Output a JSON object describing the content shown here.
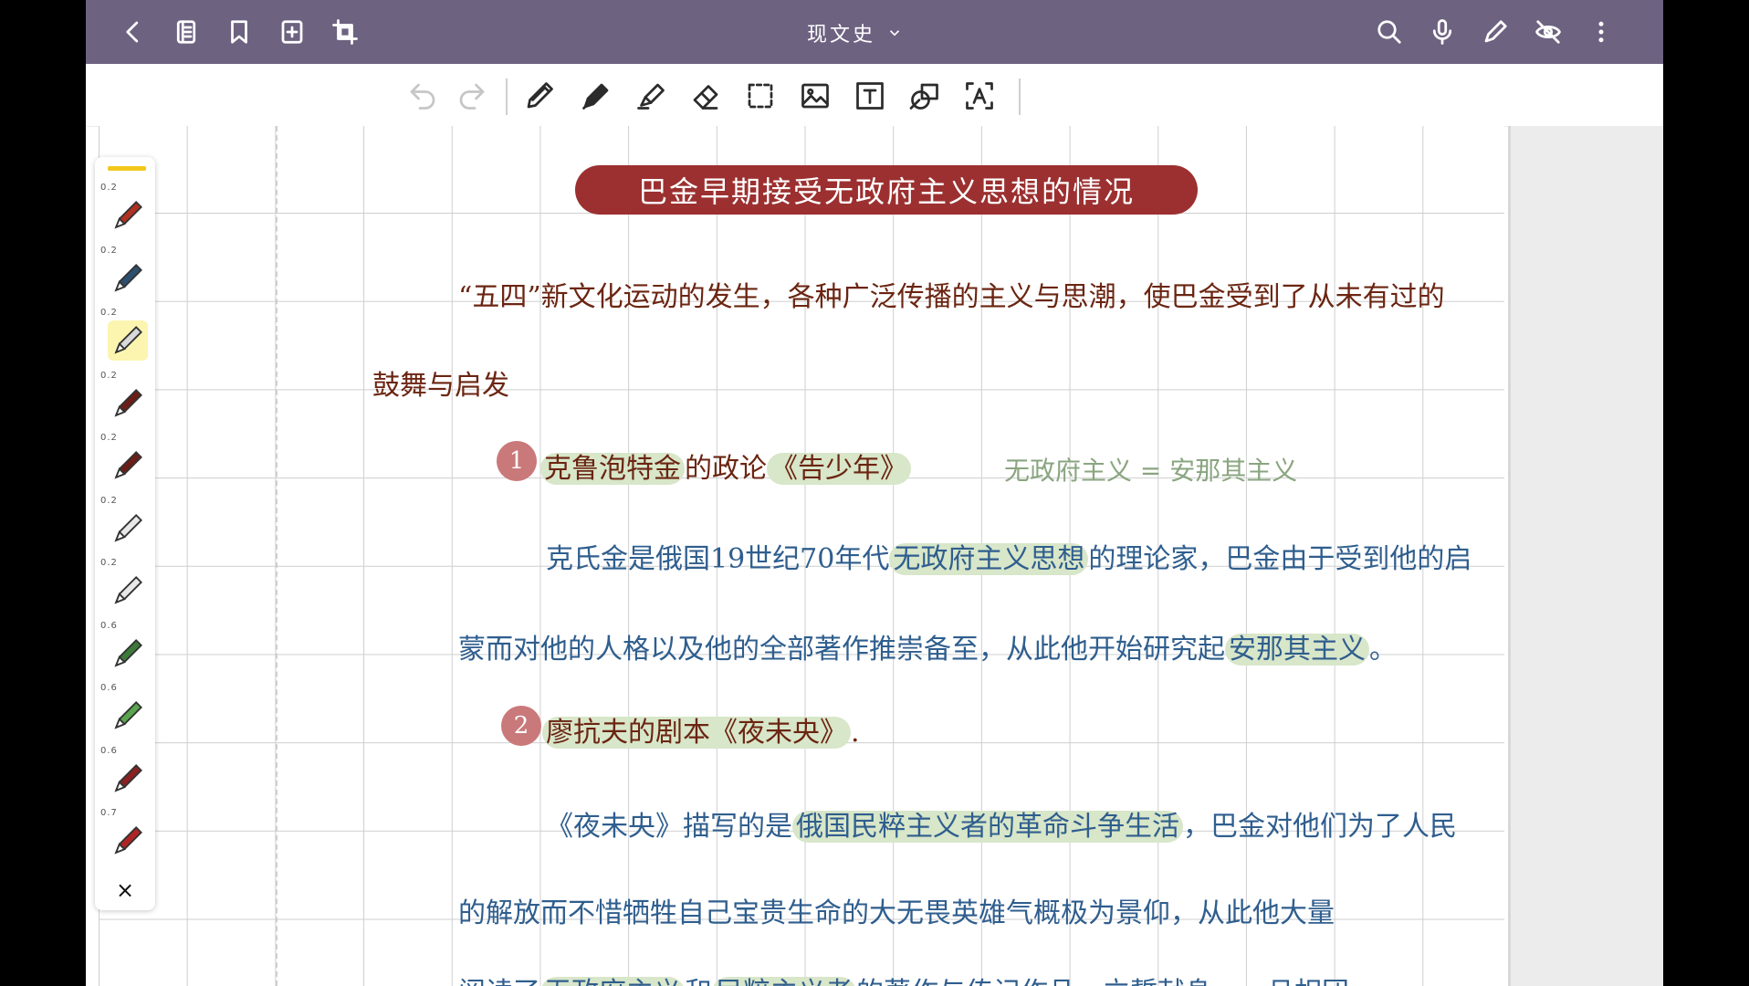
{
  "app": {
    "doc_title": "现文史",
    "colors": {
      "topbar": "#6e6281",
      "banner": "#9c3030",
      "brown_ink": "#6b2512",
      "blue_ink": "#2f5e8e",
      "highlight": "#d8e6c9",
      "badge": "#c9797a"
    }
  },
  "topbar": {
    "left_icons": [
      "back-icon",
      "pages-icon",
      "bookmark-icon",
      "add-page-icon",
      "crop-icon"
    ],
    "right_icons": [
      "search-icon",
      "microphone-icon",
      "pencil-icon",
      "eye-off-icon",
      "more-icon"
    ]
  },
  "toolbar": {
    "tools": [
      "undo-icon",
      "redo-icon",
      "pencil-tool-icon",
      "pen-tool-icon",
      "highlighter-tool-icon",
      "eraser-tool-icon",
      "lasso-select-icon",
      "image-tool-icon",
      "text-tool-icon",
      "shape-tool-icon",
      "text-recognition-icon"
    ]
  },
  "palette": {
    "pens": [
      {
        "size": "0.2",
        "color": "#b03022"
      },
      {
        "size": "0.2",
        "color": "#2c4f6e"
      },
      {
        "size": "0.2",
        "color": "#d9d9d9"
      },
      {
        "size": "0.2",
        "color": "#6b1e16"
      },
      {
        "size": "0.2",
        "color": "#6b1e16"
      },
      {
        "size": "0.2",
        "color": "#e8e8e8"
      },
      {
        "size": "0.2",
        "color": "#e8e8e8"
      },
      {
        "size": "0.6",
        "color": "#3d7a3a"
      },
      {
        "size": "0.6",
        "color": "#5aa64f"
      },
      {
        "size": "0.6",
        "color": "#8a2020"
      },
      {
        "size": "0.7",
        "color": "#b02424"
      }
    ],
    "close": "×"
  },
  "note": {
    "title": "巴金早期接受无政府主义思想的情况",
    "intro_line1": "“五四”新文化运动的发生，各种广泛传播的主义与思潮，使巴金受到了从未有过的",
    "intro_line2": "鼓舞与启发",
    "item1": {
      "number": "1",
      "hl_a": "克鲁泡特金",
      "mid": "的政论",
      "hl_b": "《告少年》"
    },
    "side_note": "无政府主义 = 安那其主义",
    "item1_body": {
      "line1_a": "克氏金是俄国19世纪70年代",
      "line1_hl": "无政府主义思想",
      "line1_b": "的理论家，巴金由于受到他的启",
      "line2_a": "蒙而对他的人格以及他的全部著作推崇备至，从此他开始研究起",
      "line2_hl": "安那其主义",
      "line2_b": "。"
    },
    "item2": {
      "number": "2",
      "hl": "廖抗夫的剧本《夜未央》",
      "end": "."
    },
    "item2_body": {
      "line1_a": "《夜未央》描写的是",
      "line1_hl": "俄国民粹主义者的革命斗争生活",
      "line1_b": "，巴金对他们为了人民",
      "line2": "的解放而不惜牺牲自己宝贵生命的大无畏英雄气概极为景仰，从此他大量",
      "line3_a": "阅读了",
      "line3_hl1": "无政府主义",
      "line3_mid": "和",
      "line3_hl2": "民粹主义者",
      "line3_b": "的著作与传记作品，立誓献身……且相团"
    }
  }
}
